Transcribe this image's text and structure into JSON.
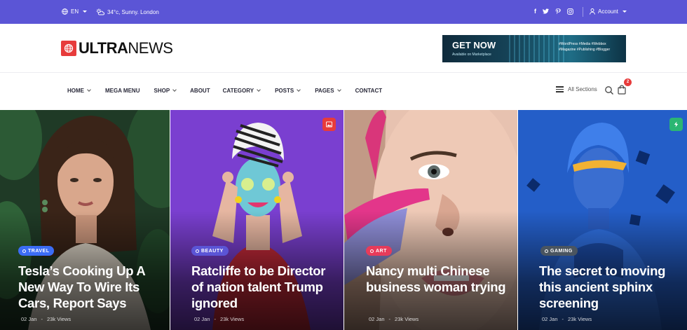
{
  "topbar": {
    "language": "EN",
    "weather": "34°c, Sunny. London",
    "social_icons": [
      "facebook-icon",
      "twitter-icon",
      "pinterest-icon",
      "instagram-icon"
    ],
    "account_label": "Account",
    "color": "#5b55d6"
  },
  "header": {
    "logo_bold": "ULTRA",
    "logo_light": "NEWS",
    "ad": {
      "headline": "GET NOW",
      "sub": "Available on Marketplace",
      "tags": "#WordPress #Media #Webbox #Magazine #Publishing #Blogger"
    }
  },
  "nav": {
    "items": [
      {
        "label": "HOME",
        "dropdown": true
      },
      {
        "label": "MEGA MENU",
        "dropdown": false
      },
      {
        "label": "SHOP",
        "dropdown": true
      },
      {
        "label": "ABOUT",
        "dropdown": false
      },
      {
        "label": "CATEGORY",
        "dropdown": true
      },
      {
        "label": "POSTS",
        "dropdown": true
      },
      {
        "label": "PAGES",
        "dropdown": true
      },
      {
        "label": "CONTACT",
        "dropdown": false
      }
    ],
    "all_sections": "All Sections",
    "cart_count": "2"
  },
  "cards": [
    {
      "category": "TRAVEL",
      "category_color": "#3b6cf5",
      "title": "Tesla’s Cooking Up A New Way To Wire Its Cars, Report Says",
      "date": "02 Jan",
      "views": "23k Views",
      "badge_icon": null
    },
    {
      "category": "BEAUTY",
      "category_color": "#5b55d6",
      "title": "Ratcliffe to be Director of nation talent Trump ignored",
      "date": "02 Jan",
      "views": "23k Views",
      "badge_icon": "image-icon",
      "badge_color": "#e73b3b"
    },
    {
      "category": "ART",
      "category_color": "#e73b5a",
      "title": "Nancy multi Chinese business woman trying",
      "date": "02 Jan",
      "views": "23k Views",
      "badge_icon": null
    },
    {
      "category": "GAMING",
      "category_color": "#4a5560",
      "title": "The secret to moving this ancient sphinx screening",
      "date": "02 Jan",
      "views": "23k Views",
      "badge_icon": "bolt-icon",
      "badge_color": "#2bb673"
    }
  ]
}
